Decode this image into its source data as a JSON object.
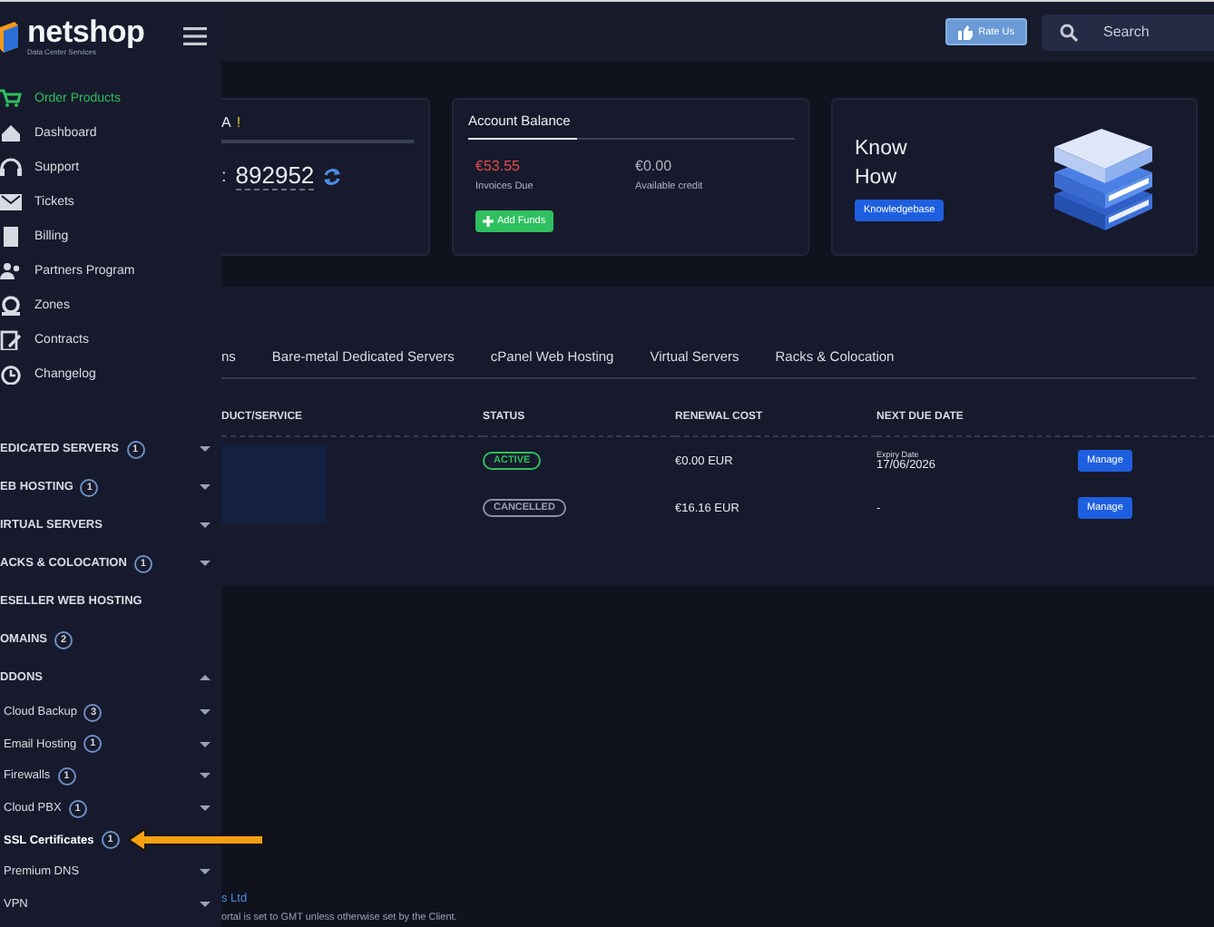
{
  "brand": {
    "name": "netshop",
    "tagline": "Data Center Services"
  },
  "sidebar": {
    "nav": [
      {
        "label": "Order Products",
        "selected": true
      },
      {
        "label": "Dashboard",
        "selected": false
      },
      {
        "label": "Support",
        "selected": false
      },
      {
        "label": "Tickets",
        "selected": false
      },
      {
        "label": "Billing",
        "selected": false
      },
      {
        "label": "Partners Program",
        "selected": false
      },
      {
        "label": "Zones",
        "selected": false
      },
      {
        "label": "Contracts",
        "selected": false
      },
      {
        "label": "Changelog",
        "selected": false
      }
    ],
    "sections": [
      {
        "label": "EDICATED SERVERS",
        "badge": "1",
        "expanded": false
      },
      {
        "label": "EB HOSTING",
        "badge": "1",
        "expanded": false
      },
      {
        "label": "IRTUAL SERVERS",
        "expanded": false
      },
      {
        "label": "ACKS & COLOCATION",
        "badge": "1",
        "expanded": false
      },
      {
        "label": "ESELLER WEB HOSTING"
      },
      {
        "label": "OMAINS",
        "badge": "2"
      },
      {
        "label": "DDONS",
        "expanded": true,
        "children": [
          {
            "label": "Cloud Backup",
            "badge": "3",
            "expanded": false,
            "selected": false
          },
          {
            "label": "Email Hosting",
            "badge": "1",
            "expanded": false,
            "selected": false
          },
          {
            "label": "Firewalls",
            "badge": "1",
            "expanded": false,
            "selected": false
          },
          {
            "label": "Cloud PBX",
            "badge": "1",
            "expanded": false,
            "selected": false
          },
          {
            "label": "SSL Certificates",
            "badge": "1",
            "selected": true
          },
          {
            "label": "Premium DNS",
            "expanded": false,
            "selected": false
          },
          {
            "label": "VPN",
            "expanded": false,
            "selected": false
          }
        ]
      }
    ]
  },
  "topbar": {
    "rate_button": "Rate Us",
    "search": {
      "placeholder": "Search"
    }
  },
  "cards": {
    "security": {
      "title": "A",
      "alert": "!",
      "prefix": ":",
      "code": "892952"
    },
    "balance": {
      "title": "Account Balance",
      "due_amount": "€53.55",
      "due_label": "Invoices Due",
      "credit": "€0.00",
      "credit_label": "Available credit",
      "button": "Add Funds"
    },
    "knowhow": {
      "title": "Know How",
      "button": "Knowledgebase"
    }
  },
  "products": {
    "tabs": [
      {
        "label": "ns",
        "selected": false
      },
      {
        "label": "Bare-metal Dedicated Servers",
        "selected": false
      },
      {
        "label": "cPanel Web Hosting",
        "selected": false
      },
      {
        "label": "Virtual Servers",
        "selected": false
      },
      {
        "label": "Racks & Colocation",
        "selected": false
      }
    ],
    "columns": [
      "DUCT/SERVICE",
      "STATUS",
      "RENEWAL COST",
      "NEXT DUE DATE"
    ],
    "rows": [
      {
        "status": "ACTIVE",
        "kind": "active",
        "cost": "€0.00 EUR",
        "due_label": "Expiry Date",
        "due": "17/06/2026",
        "action": "Manage"
      },
      {
        "status": "CANCELLED",
        "kind": "cancelled",
        "cost": "€16.16 EUR",
        "due": "-",
        "action": "Manage"
      }
    ]
  },
  "footer": {
    "company": "s Ltd",
    "note": "ortal is set to GMT unless otherwise set by the Client."
  }
}
